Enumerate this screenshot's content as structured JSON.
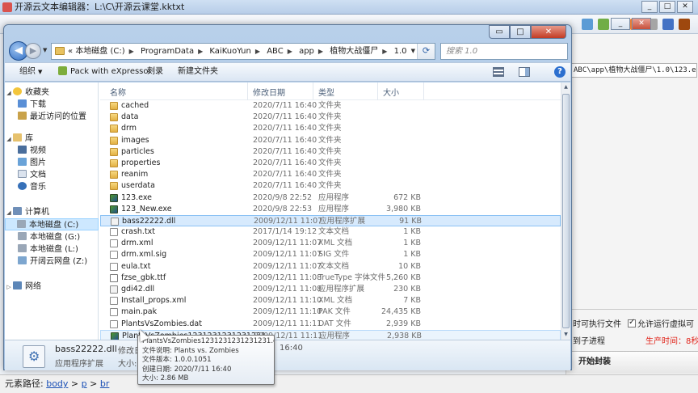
{
  "editor": {
    "title": "开源云文本编辑器：L:\\C\\开源云课堂.kktxt",
    "status_label": "元素路径:",
    "status_path": [
      "body",
      "p",
      "br"
    ]
  },
  "explorer": {
    "window_controls": {
      "min": "▭",
      "max": "□",
      "close": "✕"
    },
    "address": {
      "prefix": "«",
      "crumbs": [
        "本地磁盘 (C:)",
        "ProgramData",
        "KaiKuoYun",
        "ABC",
        "app",
        "植物大战僵尸",
        "1.0"
      ]
    },
    "search_placeholder": "搜索 1.0",
    "command_bar": {
      "organize": "组织",
      "express": "Pack with eXpressor",
      "burn": "刻录",
      "new_folder": "新建文件夹"
    },
    "nav_pane": {
      "favorites": "收藏夹",
      "downloads": "下载",
      "recent": "最近访问的位置",
      "libraries": "库",
      "videos": "视频",
      "pictures": "图片",
      "documents": "文档",
      "music": "音乐",
      "computer": "计算机",
      "drive_c": "本地磁盘 (C:)",
      "drive_g": "本地磁盘 (G:)",
      "drive_l": "本地磁盘 (L:)",
      "drive_z": "开阔云网盘 (Z:)",
      "network": "网络"
    },
    "columns": {
      "name": "名称",
      "date": "修改日期",
      "type": "类型",
      "size": "大小"
    },
    "files": [
      {
        "name": "cached",
        "date": "2020/7/11 16:40",
        "type": "文件夹",
        "size": "",
        "kind": "folder"
      },
      {
        "name": "data",
        "date": "2020/7/11 16:40",
        "type": "文件夹",
        "size": "",
        "kind": "folder"
      },
      {
        "name": "drm",
        "date": "2020/7/11 16:40",
        "type": "文件夹",
        "size": "",
        "kind": "folder"
      },
      {
        "name": "images",
        "date": "2020/7/11 16:40",
        "type": "文件夹",
        "size": "",
        "kind": "folder"
      },
      {
        "name": "particles",
        "date": "2020/7/11 16:40",
        "type": "文件夹",
        "size": "",
        "kind": "folder"
      },
      {
        "name": "properties",
        "date": "2020/7/11 16:40",
        "type": "文件夹",
        "size": "",
        "kind": "folder"
      },
      {
        "name": "reanim",
        "date": "2020/7/11 16:40",
        "type": "文件夹",
        "size": "",
        "kind": "folder"
      },
      {
        "name": "userdata",
        "date": "2020/7/11 16:40",
        "type": "文件夹",
        "size": "",
        "kind": "folder"
      },
      {
        "name": "123.exe",
        "date": "2020/9/8 22:52",
        "type": "应用程序",
        "size": "672 KB",
        "kind": "exe"
      },
      {
        "name": "123_New.exe",
        "date": "2020/9/8 22:53",
        "type": "应用程序",
        "size": "3,980 KB",
        "kind": "exe"
      },
      {
        "name": "bass22222.dll",
        "date": "2009/12/11 11:07",
        "type": "应用程序扩展",
        "size": "91 KB",
        "kind": "dll"
      },
      {
        "name": "crash.txt",
        "date": "2017/1/14 19:12",
        "type": "文本文档",
        "size": "1 KB",
        "kind": "doc"
      },
      {
        "name": "drm.xml",
        "date": "2009/12/11 11:07",
        "type": "XML 文档",
        "size": "1 KB",
        "kind": "doc"
      },
      {
        "name": "drm.xml.sig",
        "date": "2009/12/11 11:07",
        "type": "SIG 文件",
        "size": "1 KB",
        "kind": "doc"
      },
      {
        "name": "eula.txt",
        "date": "2009/12/11 11:07",
        "type": "文本文档",
        "size": "10 KB",
        "kind": "doc"
      },
      {
        "name": "fzse_gbk.ttf",
        "date": "2009/12/11 11:08",
        "type": "TrueType 字体文件",
        "size": "5,260 KB",
        "kind": "font"
      },
      {
        "name": "gdi42.dll",
        "date": "2009/12/11 11:08",
        "type": "应用程序扩展",
        "size": "230 KB",
        "kind": "dll"
      },
      {
        "name": "Install_props.xml",
        "date": "2009/12/11 11:10",
        "type": "XML 文档",
        "size": "7 KB",
        "kind": "doc"
      },
      {
        "name": "main.pak",
        "date": "2009/12/11 11:10",
        "type": "PAK 文件",
        "size": "24,435 KB",
        "kind": "doc"
      },
      {
        "name": "PlantsVsZombies.dat",
        "date": "2009/12/11 11:11",
        "type": "DAT 文件",
        "size": "2,939 KB",
        "kind": "doc"
      },
      {
        "name": "PlantsVsZombies1231231231231231...",
        "date": "2009/12/11 11:11",
        "type": "应用程序",
        "size": "2,938 KB",
        "kind": "exe"
      }
    ],
    "details": {
      "name": "bass22222.dll",
      "type": "应用程序扩展",
      "modified_label": "修改日期: 20",
      "size_label": "大小: 90",
      "time_tail": "16:40"
    }
  },
  "tooltip": {
    "line1": "PlantsVsZombies1231231231231231.exe",
    "line2": "文件说明: Plants vs. Zombies",
    "line3": "文件版本: 1.0.0.1051",
    "line4": "创建日期: 2020/7/11 16:40",
    "line5": "大小: 2.86 MB"
  },
  "right_panel": {
    "path": "ABC\\app\\植物大战僵尸\\1.0\\123.exe",
    "check1": "时可执行文件",
    "check2": "允许运行虚拟可",
    "row2_left": "到子进程",
    "row2_right": "生产时间：8秒",
    "start": "开始封装"
  }
}
